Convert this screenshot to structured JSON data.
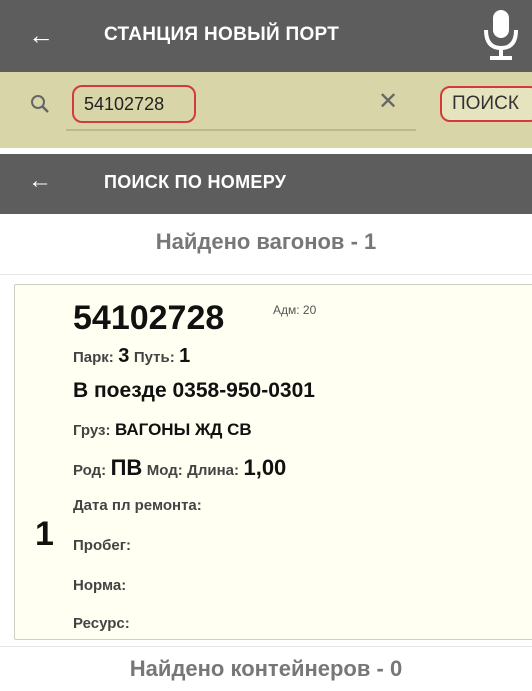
{
  "appbar": {
    "back_icon": "arrow-left-icon",
    "title": "СТАНЦИЯ НОВЫЙ ПОРТ",
    "mic_icon": "microphone-icon"
  },
  "search": {
    "icon": "search-icon",
    "value": "54102728",
    "clear_icon": "close-icon",
    "button_label": "ПОИСК"
  },
  "section": {
    "back_icon": "arrow-left-icon",
    "title": "ПОИСК ПО НОМЕРУ"
  },
  "results": {
    "found_wagons": "Найдено вагонов - 1",
    "found_containers": "Найдено контейнеров - 0"
  },
  "wagon": {
    "index": "1",
    "number": "54102728",
    "adm": "Адм: 20",
    "park_label": "Парк:",
    "park_value": "3",
    "track_label": "Путь:",
    "track_value": "1",
    "train": "В поезде 0358-950-0301",
    "cargo_label": "Груз:",
    "cargo_value": "ВАГОНЫ ЖД СВ",
    "kind_label": "Род:",
    "kind_value": "ПВ",
    "mod_label": "Мод:",
    "length_label": "Длина:",
    "length_value": "1,00",
    "repair_label": "Дата пл ремонта:",
    "mileage_label": "Пробег:",
    "norm_label": "Норма:",
    "resource_label": "Ресурс:"
  },
  "colors": {
    "appbar_bg": "#5d5d5d",
    "searchbar_bg": "#d8d6a8",
    "highlight_border": "#d53a3a",
    "card_bg": "#fffff2"
  }
}
